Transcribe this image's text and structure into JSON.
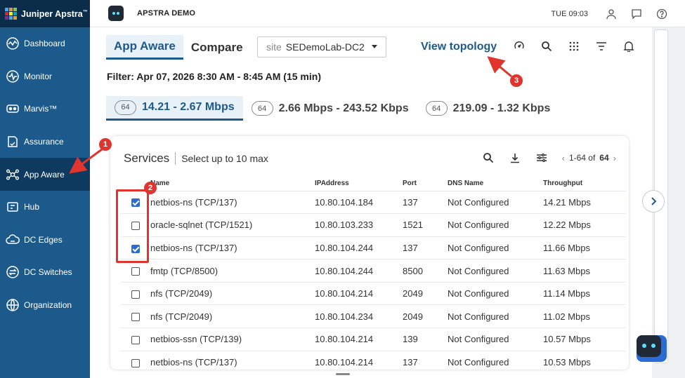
{
  "brand": {
    "name": "Juniper Apstra",
    "tm": "™"
  },
  "sidebar": {
    "items": [
      {
        "label": "Dashboard",
        "icon": "dashboard-icon",
        "active": false
      },
      {
        "label": "Monitor",
        "icon": "monitor-icon",
        "active": false
      },
      {
        "label": "Marvis™",
        "icon": "marvis-icon",
        "active": false
      },
      {
        "label": "Assurance",
        "icon": "assurance-icon",
        "active": false
      },
      {
        "label": "App Aware",
        "icon": "app-aware-icon",
        "active": true
      },
      {
        "label": "Hub",
        "icon": "hub-icon",
        "active": false
      },
      {
        "label": "DC Edges",
        "icon": "dc-edges-icon",
        "active": false
      },
      {
        "label": "DC Switches",
        "icon": "dc-switches-icon",
        "active": false
      },
      {
        "label": "Organization",
        "icon": "organization-icon",
        "active": false
      }
    ]
  },
  "header": {
    "org_title": "APSTRA DEMO",
    "clock": "TUE 09:03"
  },
  "main": {
    "tabs": [
      {
        "label": "App Aware",
        "active": true
      },
      {
        "label": "Compare",
        "active": false
      }
    ],
    "site_select": {
      "prefix": "site",
      "value": "SEDemoLab-DC2"
    },
    "view_topology": "View topology",
    "filter": "Filter: Apr 07, 2026 8:30 AM - 8:45 AM (15 min)",
    "ranges": [
      {
        "count": "64",
        "label": "14.21 - 2.67 Mbps",
        "active": true
      },
      {
        "count": "64",
        "label": "2.66 Mbps - 243.52 Kbps",
        "active": false
      },
      {
        "count": "64",
        "label": "219.09 - 1.32 Kbps",
        "active": false
      }
    ]
  },
  "services": {
    "title": "Services",
    "subtitle": "Select up to 10 max",
    "pager": {
      "range": "1-64 of",
      "total": "64"
    },
    "columns": [
      "Name",
      "IPAddress",
      "Port",
      "DNS Name",
      "Throughput"
    ],
    "rows": [
      {
        "checked": true,
        "name": "netbios-ns (TCP/137)",
        "ip": "10.80.104.184",
        "port": "137",
        "dns": "Not Configured",
        "throughput": "14.21 Mbps"
      },
      {
        "checked": false,
        "name": "oracle-sqlnet (TCP/1521)",
        "ip": "10.80.103.233",
        "port": "1521",
        "dns": "Not Configured",
        "throughput": "12.22 Mbps"
      },
      {
        "checked": true,
        "name": "netbios-ns (TCP/137)",
        "ip": "10.80.104.244",
        "port": "137",
        "dns": "Not Configured",
        "throughput": "11.66 Mbps"
      },
      {
        "checked": false,
        "name": "fmtp (TCP/8500)",
        "ip": "10.80.104.244",
        "port": "8500",
        "dns": "Not Configured",
        "throughput": "11.63 Mbps"
      },
      {
        "checked": false,
        "name": "nfs (TCP/2049)",
        "ip": "10.80.104.214",
        "port": "2049",
        "dns": "Not Configured",
        "throughput": "11.14 Mbps"
      },
      {
        "checked": false,
        "name": "nfs (TCP/2049)",
        "ip": "10.80.104.234",
        "port": "2049",
        "dns": "Not Configured",
        "throughput": "11.02 Mbps"
      },
      {
        "checked": false,
        "name": "netbios-ssn (TCP/139)",
        "ip": "10.80.104.214",
        "port": "139",
        "dns": "Not Configured",
        "throughput": "10.57 Mbps"
      },
      {
        "checked": false,
        "name": "netbios-ns (TCP/137)",
        "ip": "10.80.104.214",
        "port": "137",
        "dns": "Not Configured",
        "throughput": "10.53 Mbps"
      }
    ]
  },
  "annotations": [
    "1",
    "2",
    "3"
  ],
  "colors": {
    "sidebar": "#1d5a8c",
    "accent": "#1d5a8c",
    "annotation": "#e0342e",
    "checkbox": "#2a6bd6"
  }
}
